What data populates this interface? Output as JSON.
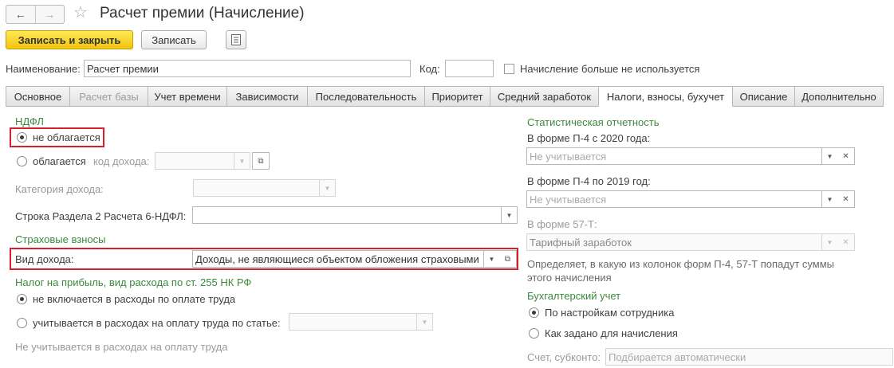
{
  "window": {
    "title": "Расчет премии (Начисление)"
  },
  "toolbar": {
    "save_close_label": "Записать и закрыть",
    "save_label": "Записать"
  },
  "header": {
    "name_label": "Наименование:",
    "name_value": "Расчет премии",
    "code_label": "Код:",
    "code_value": "",
    "unused_label": "Начисление больше не используется"
  },
  "tabs": [
    {
      "label": "Основное"
    },
    {
      "label": "Расчет базы"
    },
    {
      "label": "Учет времени"
    },
    {
      "label": "Зависимости"
    },
    {
      "label": "Последовательность"
    },
    {
      "label": "Приоритет"
    },
    {
      "label": "Средний заработок"
    },
    {
      "label": "Налоги, взносы, бухучет"
    },
    {
      "label": "Описание"
    },
    {
      "label": "Дополнительно"
    }
  ],
  "ndfl": {
    "title": "НДФЛ",
    "option_not_taxed": "не облагается",
    "option_taxed": "облагается",
    "income_code_label": "код дохода:",
    "income_category_label": "Категория дохода:",
    "row6_label": "Строка Раздела 2 Расчета 6-НДФЛ:"
  },
  "insurance": {
    "title": "Страховые взносы",
    "income_type_label": "Вид дохода:",
    "income_type_value": "Доходы, не являющиеся объектом обложения страховыми"
  },
  "profit_tax": {
    "title": "Налог на прибыль, вид расхода по ст. 255 НК РФ",
    "option_not_included": "не включается в расходы по оплате труда",
    "option_by_article": "учитывается в расходах на оплату труда по статье:",
    "note": "Не учитывается в расходах на оплату труда"
  },
  "stats": {
    "title": "Статистическая отчетность",
    "p4_2020_label": "В форме П-4 с 2020 года:",
    "p4_2020_placeholder": "Не учитывается",
    "p4_2019_label": "В форме П-4 по 2019 год:",
    "p4_2019_placeholder": "Не учитывается",
    "f57t_label": "В форме 57-Т:",
    "f57t_value": "Тарифный заработок",
    "note": "Определяет, в какую из колонок форм П-4, 57-Т попадут суммы этого начисления"
  },
  "accounting": {
    "title": "Бухгалтерский учет",
    "option_by_employee": "По настройкам сотрудника",
    "option_as_set": "Как задано для начисления",
    "account_label": "Счет, субконто:",
    "account_placeholder": "Подбирается автоматически"
  }
}
